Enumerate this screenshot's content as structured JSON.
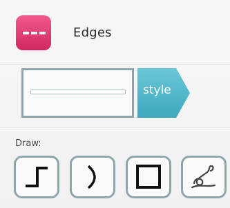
{
  "header": {
    "title": "Edges",
    "icon": "edges-icon",
    "icon_color": "#d92d66"
  },
  "style": {
    "preview_icon": "line-edge-preview",
    "button_label": "style",
    "button_color": "#4fb6c9"
  },
  "draw": {
    "label": "Draw:",
    "tools": [
      {
        "name": "orthogonal-edge",
        "icon": "step-line-icon"
      },
      {
        "name": "curved-edge",
        "icon": "arc-icon"
      },
      {
        "name": "rectangle",
        "icon": "square-icon"
      },
      {
        "name": "freehand",
        "icon": "freehand-icon"
      }
    ]
  },
  "colors": {
    "border": "#8fa5ad",
    "background": "#f4f4f4"
  }
}
